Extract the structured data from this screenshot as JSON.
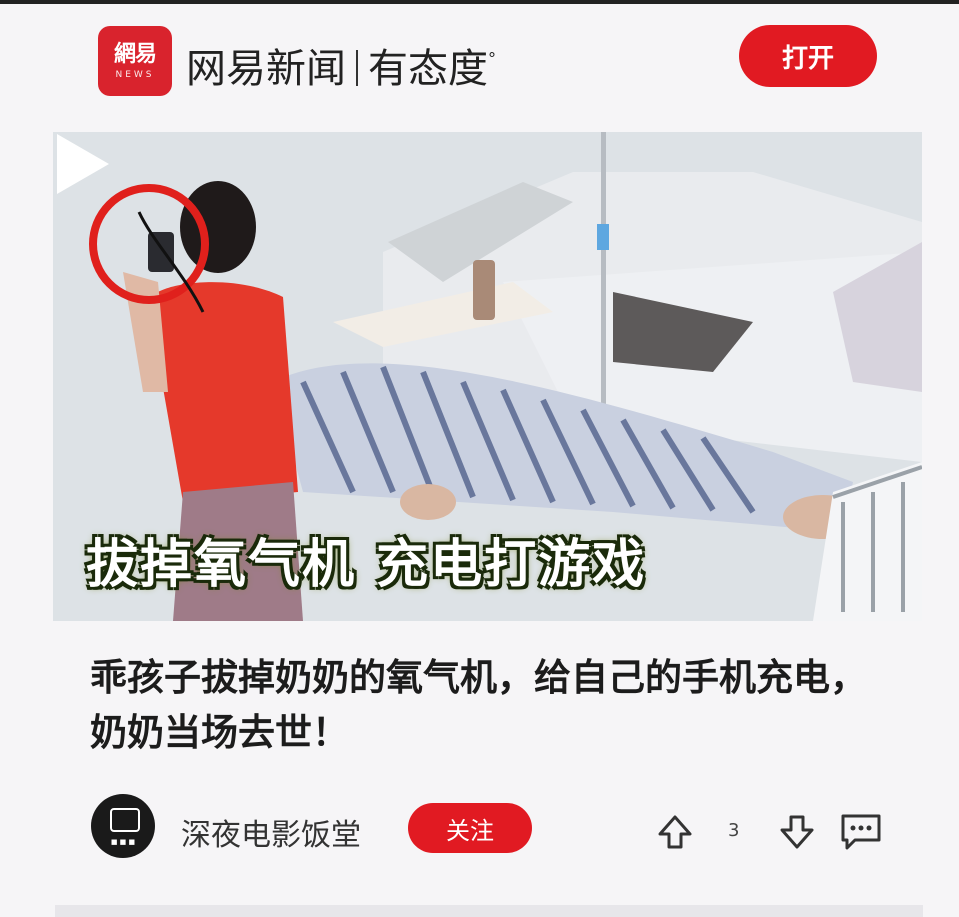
{
  "header": {
    "logo_main": "網易",
    "logo_sub": "NEWS",
    "brand_name": "网易新闻",
    "brand_slogan": "有态度",
    "slogan_mark": "°",
    "open_label": "打开",
    "accent": "#e11a22"
  },
  "video": {
    "overlay_caption": "拔掉氧气机 充电打游戏",
    "play_icon": "play-icon"
  },
  "article": {
    "headline": "乖孩子拔掉奶奶的氧气机，给自己的手机充电，奶奶当场去世！"
  },
  "footer": {
    "author": "深夜电影饭堂",
    "follow_label": "关注",
    "vote_count": "3",
    "icons": [
      "upvote-icon",
      "downvote-icon",
      "comment-icon"
    ]
  }
}
